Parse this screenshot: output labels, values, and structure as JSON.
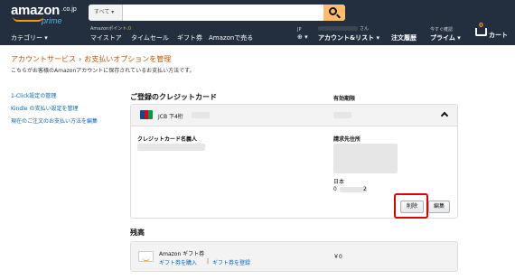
{
  "header": {
    "logo": {
      "word": "amazon",
      "suffix": ".co.jp",
      "sub": "prime"
    },
    "search": {
      "category": "すべて ▾",
      "value": ""
    },
    "categories": "カテゴリー ▾",
    "points_label": "Amazonポイント:",
    "points_value": "0",
    "nav_links": [
      "マイストア",
      "タイムセール",
      "ギフト券",
      "Amazonで売る"
    ],
    "lang_small": "JP",
    "lang_globe": "⊕ ▾",
    "account_small": "さん",
    "account_label": "アカウント&リスト ▾",
    "orders_label": "注文履歴",
    "prime_small": "今すぐ確認",
    "prime_label": "プライム ▾",
    "cart_count": "0",
    "cart_label": "カート"
  },
  "breadcrumb": {
    "parent": "アカウントサービス",
    "separator": "›",
    "current": "お支払いオプションを管理"
  },
  "subtitle": "こちらがお客様のAmazonアカウントに保存されているお支払い方法です。",
  "sidebar": {
    "links": [
      "1-Click設定の管理",
      "Kindle の支払い設定を管理",
      "現在のご注文のお支払い方法を編集"
    ]
  },
  "cards_section": {
    "title": "ご登録のクレジットカード",
    "expiry_header": "有効期限",
    "card": {
      "brand": "JCB",
      "name": "JCB 下4桁",
      "holder_label": "クレジットカード名義人",
      "billing_label": "請求先住所",
      "country": "日本",
      "postal_start": "0",
      "postal_end": "2",
      "brand_colors": [
        "#0e4c96",
        "#e60012",
        "#009944"
      ]
    },
    "delete_label": "削除",
    "edit_label": "編集",
    "highlight_color": "#e00000"
  },
  "balance_section": {
    "title": "残高",
    "gift": {
      "title": "Amazon ギフト券",
      "buy_link": "ギフト券を購入",
      "separator": "|",
      "register_link": "ギフト券を登録",
      "amount": "￥0"
    }
  }
}
